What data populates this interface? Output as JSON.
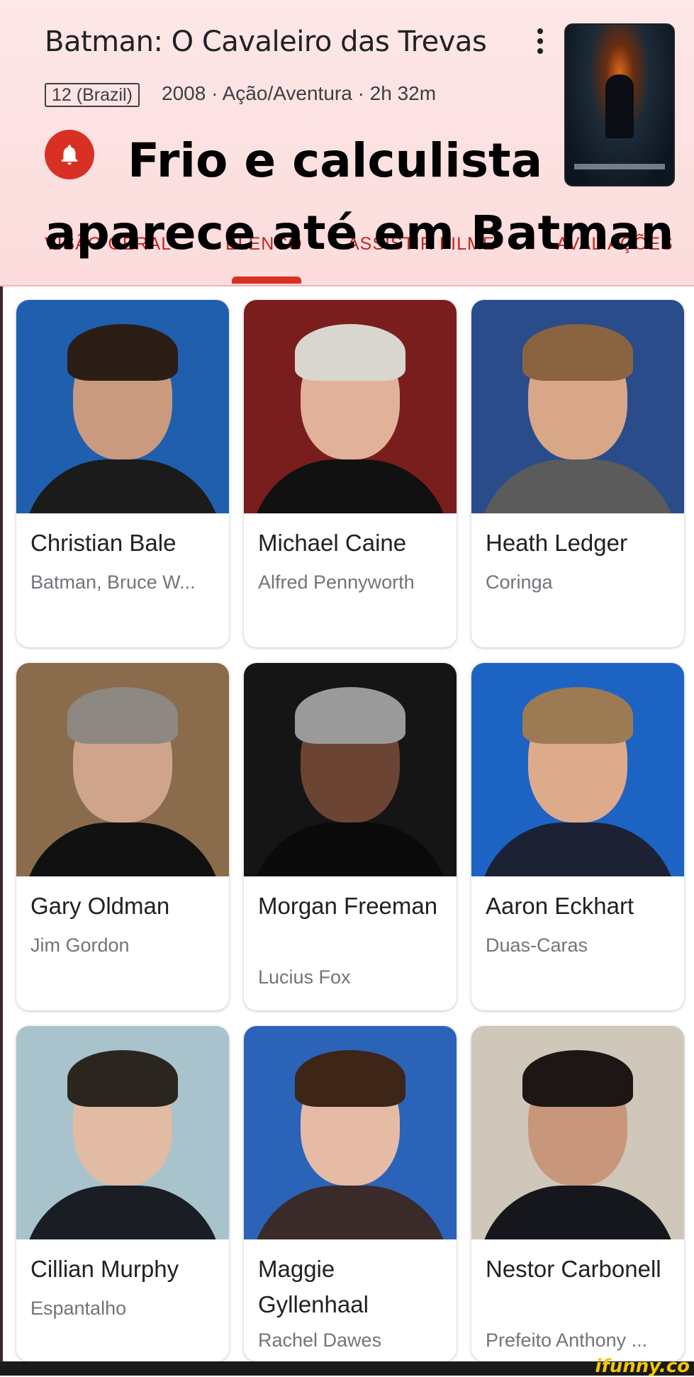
{
  "header": {
    "title": "Batman: O Cavaleiro das Trevas",
    "rating": "12 (Brazil)",
    "meta": "2008 · Ação/Aventura · 2h 32m"
  },
  "meme": {
    "line1": "Frio e calculista",
    "line2": "aparece até em Batman"
  },
  "tabs": [
    {
      "label": "VISÃO GERAL"
    },
    {
      "label": "ELENCO"
    },
    {
      "label": "ASSISTIR FILME"
    },
    {
      "label": "AVALIAÇÕES"
    }
  ],
  "cast": [
    {
      "name": "Christian Bale",
      "role": "Batman, Bruce W..."
    },
    {
      "name": "Michael Caine",
      "role": "Alfred Pennyworth"
    },
    {
      "name": "Heath Ledger",
      "role": "Coringa"
    },
    {
      "name": "Gary Oldman",
      "role": "Jim Gordon"
    },
    {
      "name": "Morgan Freeman",
      "role": "Lucius Fox"
    },
    {
      "name": "Aaron Eckhart",
      "role": "Duas-Caras"
    },
    {
      "name": "Cillian Murphy",
      "role": "Espantalho"
    },
    {
      "name": "Maggie Gyllenhaal",
      "role": "Rachel Dawes"
    },
    {
      "name": "Nestor Carbonell",
      "role": "Prefeito Anthony ..."
    }
  ],
  "watermark": "ifunny.co",
  "colors": {
    "accent": "#d93025",
    "header_bg": "#fde7e7"
  }
}
